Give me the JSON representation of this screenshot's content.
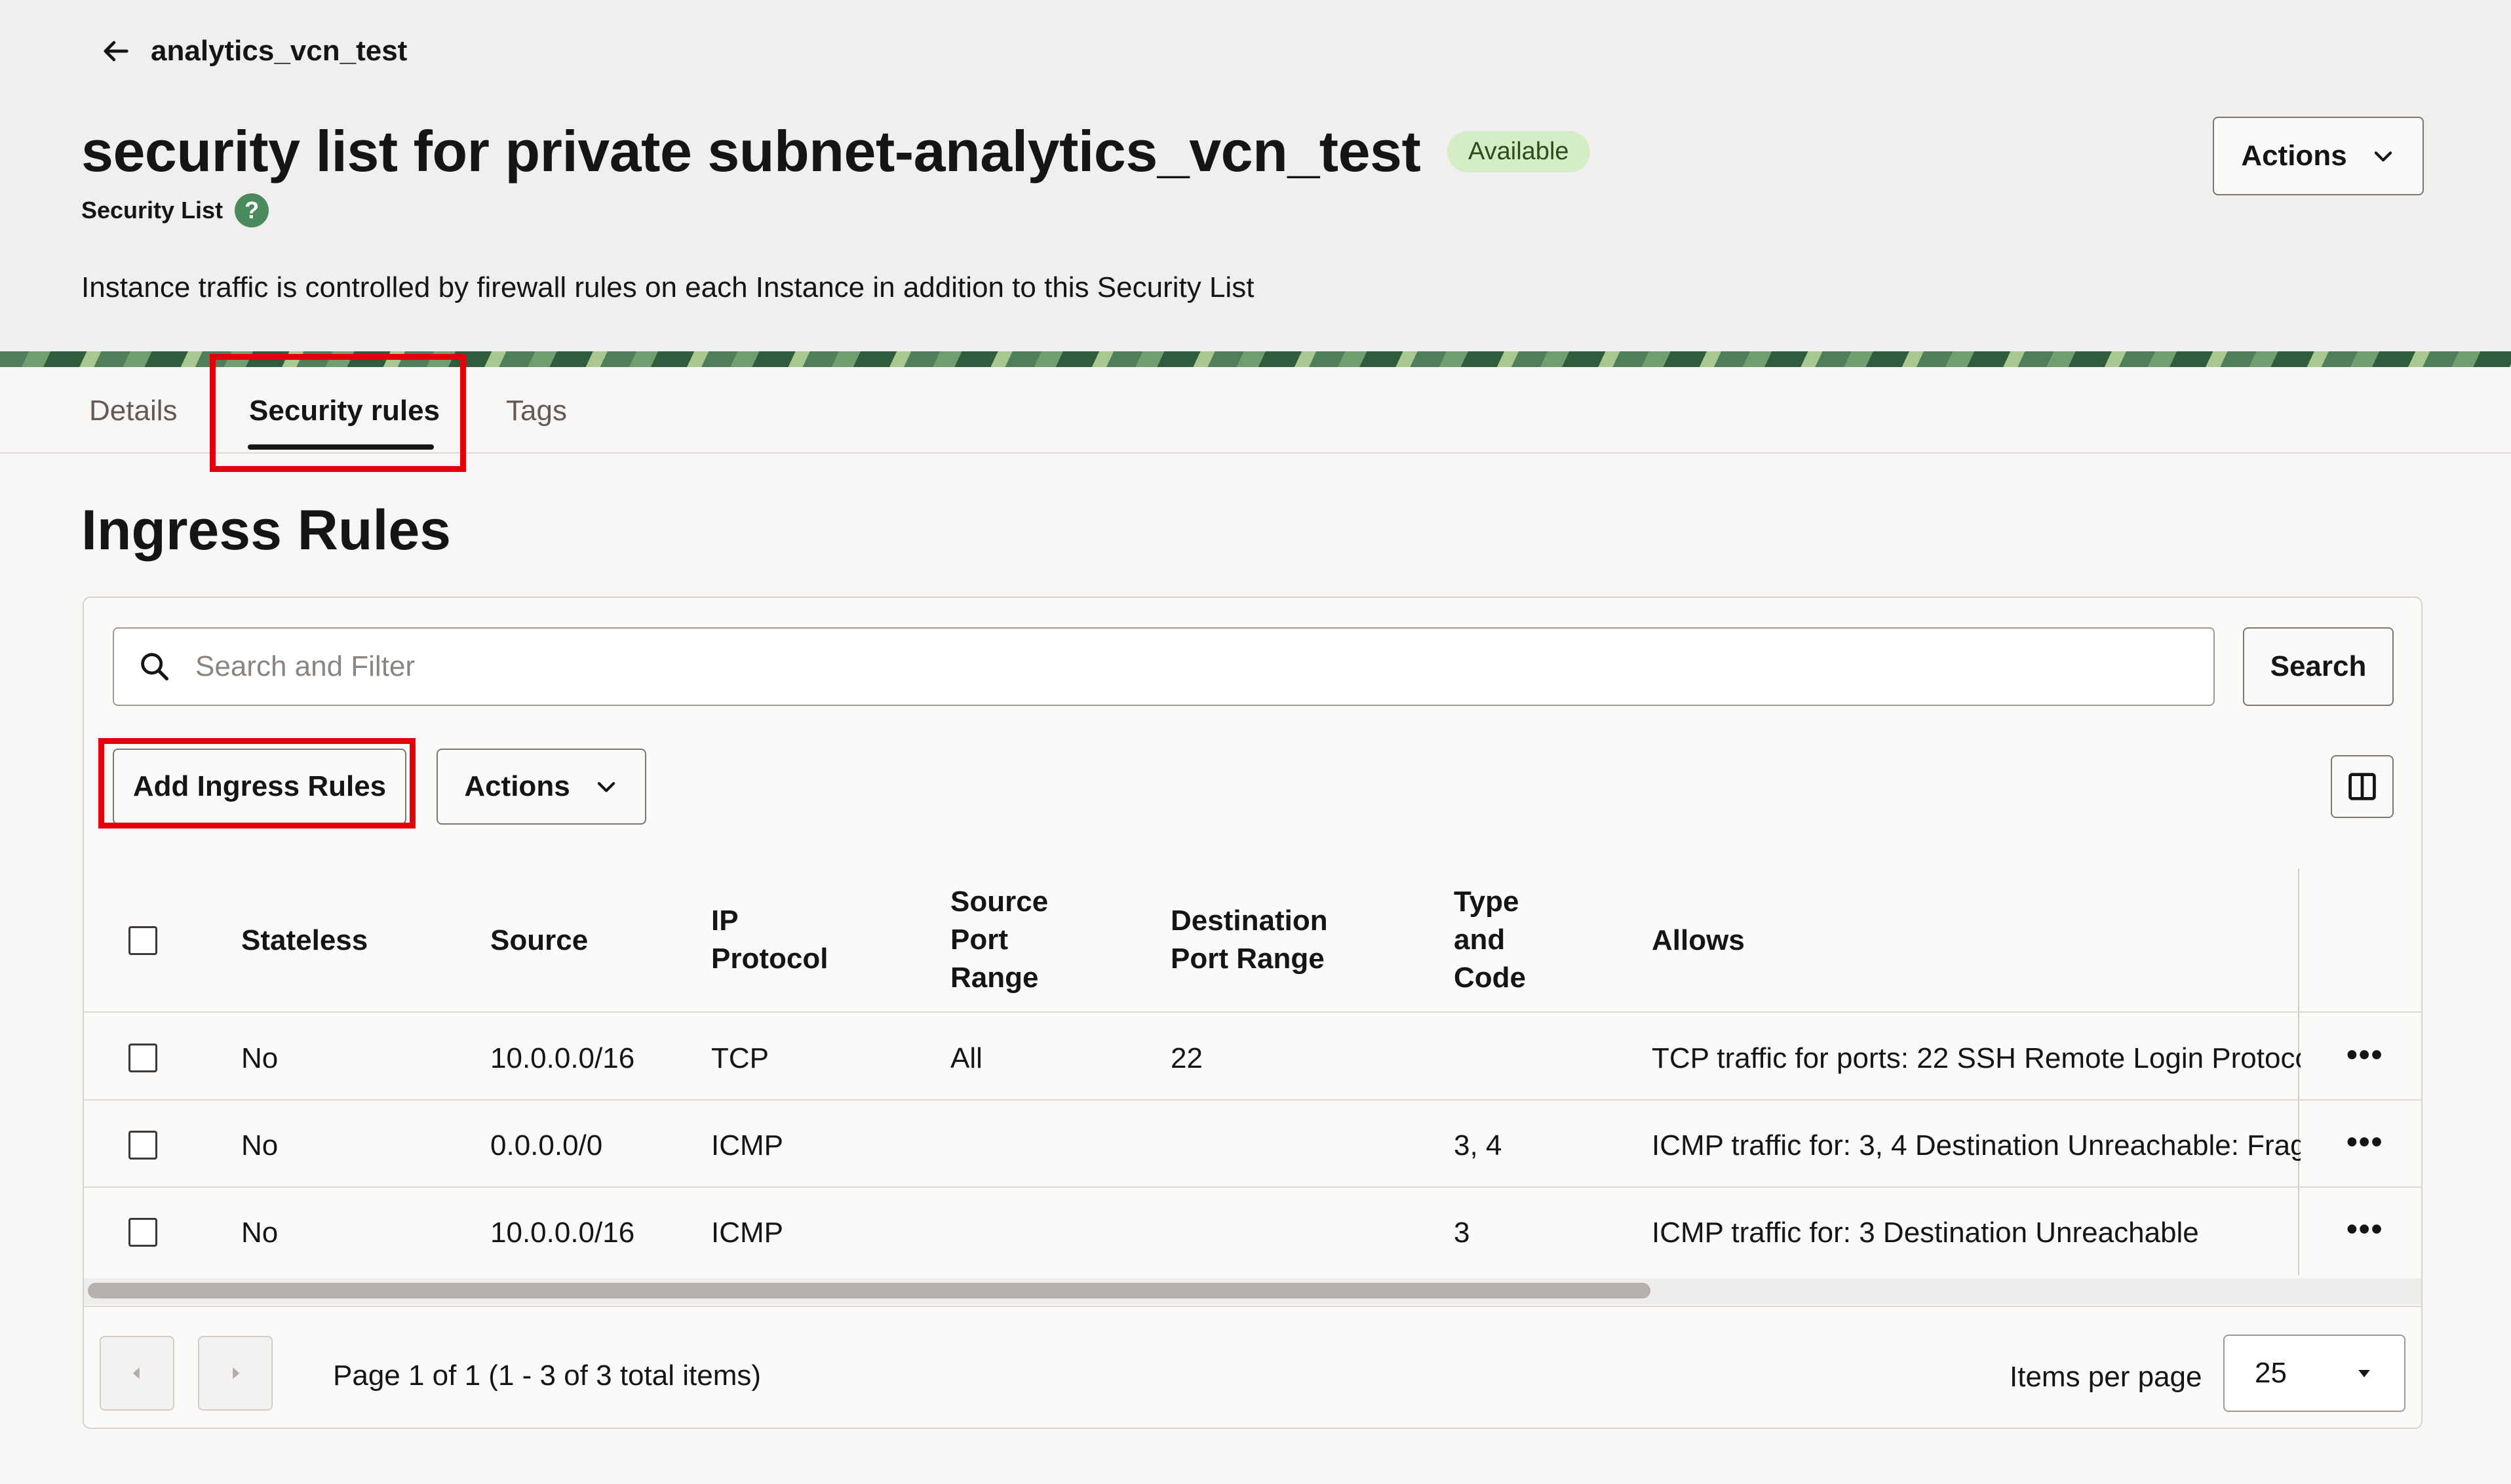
{
  "breadcrumb": {
    "back_label": "analytics_vcn_test"
  },
  "header": {
    "title": "security list for private subnet-analytics_vcn_test",
    "status_badge": "Available",
    "subtitle": "Security List",
    "help_glyph": "?",
    "description": "Instance traffic is controlled by firewall rules on each Instance in addition to this Security List",
    "actions_label": "Actions"
  },
  "tabs": [
    {
      "label": "Details"
    },
    {
      "label": "Security rules",
      "active": true
    },
    {
      "label": "Tags"
    }
  ],
  "section_title": "Ingress Rules",
  "search": {
    "placeholder": "Search and Filter",
    "button_label": "Search"
  },
  "toolbar": {
    "add_label": "Add Ingress Rules",
    "actions_label": "Actions"
  },
  "table": {
    "headers": {
      "stateless": "Stateless",
      "source": "Source",
      "ip_protocol": [
        "IP",
        "Protocol"
      ],
      "source_port": [
        "Source",
        "Port",
        "Range"
      ],
      "dest_port": [
        "Destination",
        "Port Range"
      ],
      "type_code": [
        "Type",
        "and",
        "Code"
      ],
      "allows": "Allows"
    },
    "rows": [
      {
        "stateless": "No",
        "source": "10.0.0.0/16",
        "protocol": "TCP",
        "source_port": "All",
        "dest_port": "22",
        "type_code": "",
        "allows": "TCP traffic for ports: 22 SSH Remote Login Protoco"
      },
      {
        "stateless": "No",
        "source": "0.0.0.0/0",
        "protocol": "ICMP",
        "source_port": "",
        "dest_port": "",
        "type_code": "3, 4",
        "allows": "ICMP traffic for: 3, 4 Destination Unreachable: Frag"
      },
      {
        "stateless": "No",
        "source": "10.0.0.0/16",
        "protocol": "ICMP",
        "source_port": "",
        "dest_port": "",
        "type_code": "3",
        "allows": "ICMP traffic for: 3 Destination Unreachable"
      }
    ],
    "row_menu_glyph": "•••"
  },
  "pagination": {
    "text": "Page 1 of 1 (1 - 3 of 3 total items)",
    "items_per_page_label": "Items per page",
    "items_per_page_value": "25"
  },
  "colors": {
    "highlight": "#e3000b",
    "badge_bg": "#d4edc6",
    "header_bg": "#f1efed"
  },
  "icons": [
    "arrow-left-icon",
    "help-icon",
    "chevron-down-icon",
    "search-icon",
    "columns-icon",
    "chevron-left-icon",
    "chevron-right-icon",
    "caret-down-icon",
    "more-icon"
  ]
}
